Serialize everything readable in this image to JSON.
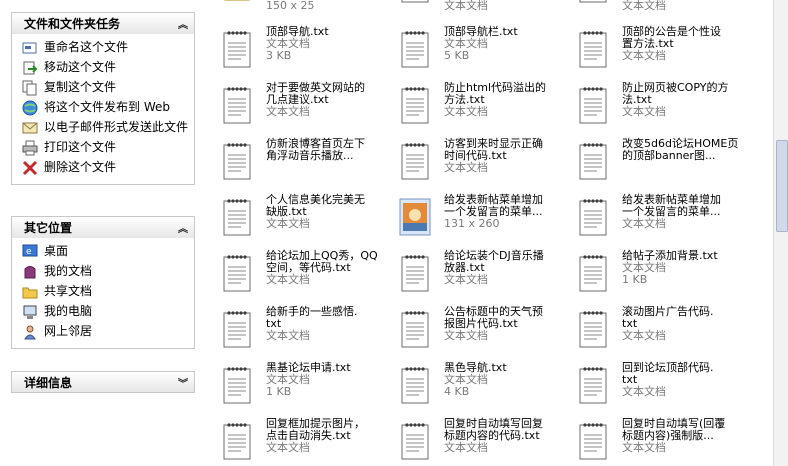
{
  "task_pane": {
    "file_tasks": {
      "title": "文件和文件夹任务",
      "items": [
        {
          "label": "重命名这个文件",
          "icon": "rename-icon"
        },
        {
          "label": "移动这个文件",
          "icon": "move-icon"
        },
        {
          "label": "复制这个文件",
          "icon": "copy-icon"
        },
        {
          "label": "将这个文件发布到 Web",
          "icon": "publish-web-icon"
        },
        {
          "label": "以电子邮件形式发送此文件",
          "icon": "email-icon"
        },
        {
          "label": "打印这个文件",
          "icon": "print-icon"
        },
        {
          "label": "删除这个文件",
          "icon": "delete-icon"
        }
      ]
    },
    "other_places": {
      "title": "其它位置",
      "items": [
        {
          "label": "桌面",
          "icon": "desktop-icon"
        },
        {
          "label": "我的文档",
          "icon": "my-documents-icon"
        },
        {
          "label": "共享文档",
          "icon": "shared-folder-icon"
        },
        {
          "label": "我的电脑",
          "icon": "my-computer-icon"
        },
        {
          "label": "网上邻居",
          "icon": "network-icon"
        }
      ]
    },
    "details": {
      "title": "详细信息"
    }
  },
  "files": [
    {
      "name": "",
      "type": "150 x 25",
      "size": "",
      "kind": "image-top"
    },
    {
      "name": "",
      "type": "文本文档",
      "size": "",
      "kind": "txt-top"
    },
    {
      "name": "",
      "type": "文本文档",
      "size": "",
      "kind": "txt-top"
    },
    {
      "name": "顶部导航.txt",
      "type": "文本文档",
      "size": "3 KB",
      "kind": "txt"
    },
    {
      "name": "顶部导航栏.txt",
      "type": "文本文档",
      "size": "5 KB",
      "kind": "txt"
    },
    {
      "name": "顶部的公告是个性设\n置方法.txt",
      "type": "文本文档",
      "size": "",
      "kind": "txt"
    },
    {
      "name": "对于要做英文网站的\n几点建议.txt",
      "type": "文本文档",
      "size": "",
      "kind": "txt"
    },
    {
      "name": "防止html代码溢出的\n方法.txt",
      "type": "文本文档",
      "size": "",
      "kind": "txt"
    },
    {
      "name": "防止网页被COPY的方\n法.txt",
      "type": "文本文档",
      "size": "",
      "kind": "txt"
    },
    {
      "name": "仿新浪博客首页左下\n角浮动音乐播放...",
      "type": "",
      "size": "",
      "kind": "txt"
    },
    {
      "name": "访客到来时显示正确\n时间代码.txt",
      "type": "文本文档",
      "size": "",
      "kind": "txt"
    },
    {
      "name": "改变5d6d论坛HOME页\n的顶部banner图...",
      "type": "",
      "size": "",
      "kind": "txt"
    },
    {
      "name": "个人信息美化完美无\n缺版.txt",
      "type": "文本文档",
      "size": "",
      "kind": "txt"
    },
    {
      "name": "给发表新帖菜单增加\n一个发留言的菜单...",
      "type": "131 x 260",
      "size": "",
      "kind": "image"
    },
    {
      "name": "给发表新帖菜单增加\n一个发留言的菜单...",
      "type": "文本文档",
      "size": "",
      "kind": "txt"
    },
    {
      "name": "给论坛加上QQ秀，QQ\n空间，等代码.txt",
      "type": "文本文档",
      "size": "",
      "kind": "txt"
    },
    {
      "name": "给论坛装个DJ音乐播\n放器.txt",
      "type": "文本文档",
      "size": "",
      "kind": "txt"
    },
    {
      "name": "给帖子添加背景.txt",
      "type": "文本文档",
      "size": "1 KB",
      "kind": "txt"
    },
    {
      "name": "给新手的一些感悟.\ntxt",
      "type": "文本文档",
      "size": "",
      "kind": "txt"
    },
    {
      "name": "公告标题中的天气预\n报图片代码.txt",
      "type": "文本文档",
      "size": "",
      "kind": "txt"
    },
    {
      "name": "滚动图片广告代码.\ntxt",
      "type": "文本文档",
      "size": "",
      "kind": "txt"
    },
    {
      "name": "黑基论坛申请.txt",
      "type": "文本文档",
      "size": "1 KB",
      "kind": "txt"
    },
    {
      "name": "黑色导航.txt",
      "type": "文本文档",
      "size": "4 KB",
      "kind": "txt"
    },
    {
      "name": "回到论坛顶部代码.\ntxt",
      "type": "文本文档",
      "size": "",
      "kind": "txt"
    },
    {
      "name": "回复框加提示图片，\n点击自动消失.txt",
      "type": "文本文档",
      "size": "",
      "kind": "txt"
    },
    {
      "name": "回复时自动填写回复\n标题内容的代码.txt",
      "type": "文本文档",
      "size": "",
      "kind": "txt"
    },
    {
      "name": "回复时自动填写(回覆\n标题内容)强制版...",
      "type": "文本文档",
      "size": "",
      "kind": "txt"
    }
  ]
}
